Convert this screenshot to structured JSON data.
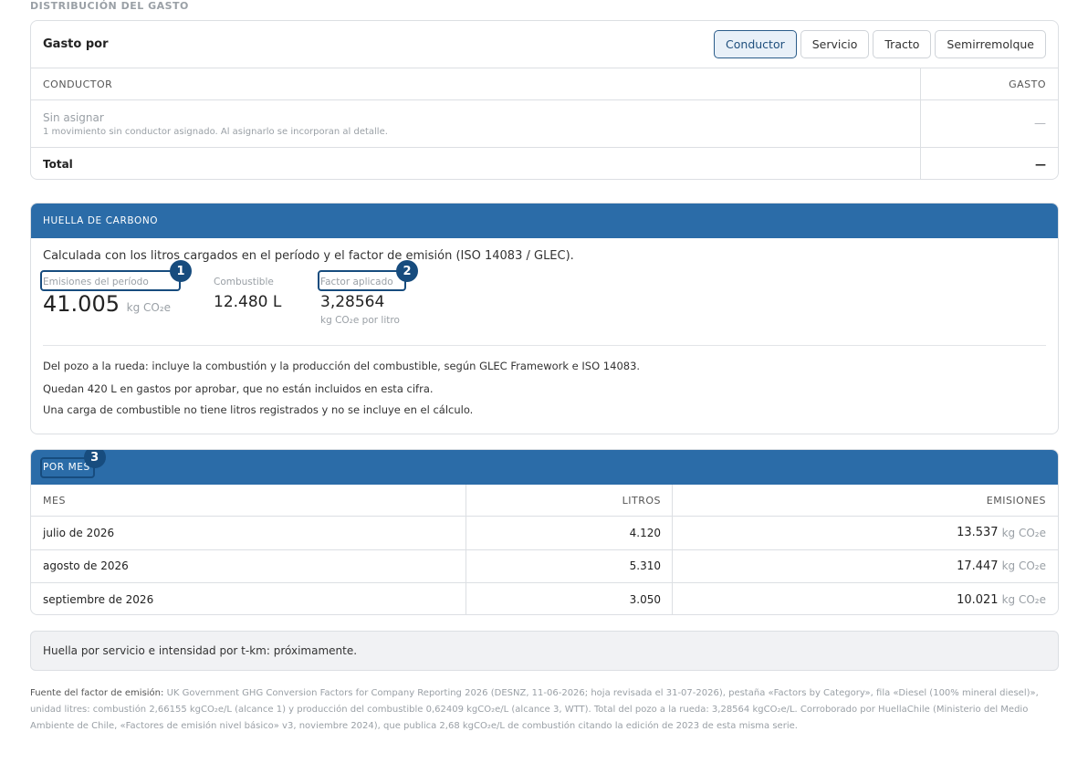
{
  "distribution": {
    "section_label": "DISTRIBUCIÓN DEL GASTO",
    "title": "Gasto por",
    "tabs": [
      "Conductor",
      "Servicio",
      "Tracto",
      "Semirremolque"
    ],
    "active_tab": "Conductor",
    "col_driver": "CONDUCTOR",
    "col_cost": "GASTO",
    "unassigned_label": "Sin asignar",
    "unassigned_note": "1 movimiento sin conductor asignado. Al asignarlo se incorporan al detalle.",
    "unassigned_value": "—",
    "total_label": "Total",
    "total_value": "—"
  },
  "carbon": {
    "header": "HUELLA DE CARBONO",
    "intro": "Calculada con los litros cargados en el período y el factor de emisión (ISO 14083 / GLEC).",
    "emissions_label": "Emisiones del período",
    "emissions_value": "41.005",
    "emissions_unit": "kg CO₂e",
    "fuel_label": "Combustible",
    "fuel_value": "12.480 L",
    "factor_label": "Factor aplicado",
    "factor_value": "3,28564",
    "factor_unit": "kg CO₂e por litro",
    "note_1": "Del pozo a la rueda: incluye la combustión y la producción del combustible, según GLEC Framework e ISO 14083.",
    "note_2": "Quedan 420 L en gastos por aprobar, que no están incluidos en esta cifra.",
    "note_3": "Una carga de combustible no tiene litros registrados y no se incluye en el cálculo."
  },
  "badges": [
    "1",
    "2",
    "3"
  ],
  "monthly": {
    "header": "POR MES",
    "col_month": "MES",
    "col_liters": "LITROS",
    "col_emissions": "EMISIONES",
    "unit": "kg CO₂e",
    "rows": [
      {
        "month": "julio de 2026",
        "liters": "4.120",
        "emissions": "13.537"
      },
      {
        "month": "agosto de 2026",
        "liters": "5.310",
        "emissions": "17.447"
      },
      {
        "month": "septiembre de 2026",
        "liters": "3.050",
        "emissions": "10.021"
      }
    ]
  },
  "coming_soon": "Huella por servicio e intensidad por t-km: próximamente.",
  "source": {
    "label": "Fuente del factor de emisión:",
    "text": "UK Government GHG Conversion Factors for Company Reporting 2026 (DESNZ, 11-06-2026; hoja revisada el 31-07-2026), pestaña «Factors by Category», fila «Diesel (100% mineral diesel)», unidad litres: combustión 2,66155 kgCO₂e/L (alcance 1) y producción del combustible 0,62409 kgCO₂e/L (alcance 3, WTT). Total del pozo a la rueda: 3,28564 kgCO₂e/L. Corroborado por HuellaChile (Ministerio del Medio Ambiente de Chile, «Factores de emisión nivel básico» v3, noviembre 2024), que publica 2,68 kgCO₂e/L de combustión citando la edición de 2023 de esta misma serie."
  }
}
